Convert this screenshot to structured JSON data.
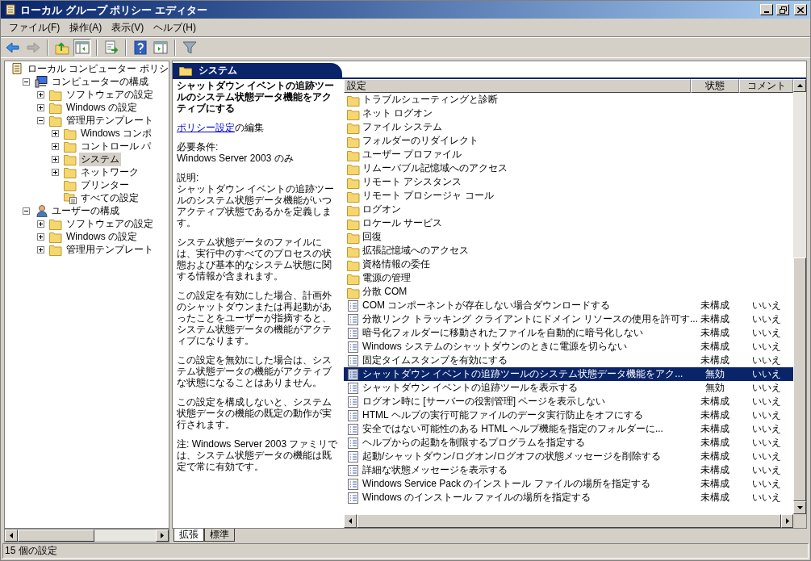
{
  "window": {
    "title": "ローカル グループ ポリシー エディター"
  },
  "menu": [
    "ファイル(F)",
    "操作(A)",
    "表示(V)",
    "ヘルプ(H)"
  ],
  "toolbar": [
    {
      "kind": "back",
      "disabled": false
    },
    {
      "kind": "forward",
      "disabled": true
    },
    {
      "kind": "sep"
    },
    {
      "kind": "up",
      "disabled": false
    },
    {
      "kind": "pane",
      "disabled": false,
      "selected": true
    },
    {
      "kind": "sep"
    },
    {
      "kind": "export",
      "disabled": false
    },
    {
      "kind": "sep"
    },
    {
      "kind": "help",
      "disabled": false
    },
    {
      "kind": "pane2",
      "disabled": false
    },
    {
      "kind": "sep"
    },
    {
      "kind": "filter",
      "disabled": false
    }
  ],
  "tree": [
    {
      "label": "ローカル コンピューター ポリシ",
      "kind": "doc",
      "has_toggle": false,
      "selected": false,
      "children": [
        {
          "label": "コンピューターの構成",
          "kind": "computer",
          "has_toggle": true,
          "selected": false,
          "children": [
            {
              "label": "ソフトウェアの設定",
              "kind": "folder",
              "has_toggle": true,
              "selected": false
            },
            {
              "label": "Windows の設定",
              "kind": "folder",
              "has_toggle": true,
              "selected": false
            },
            {
              "label": "管理用テンプレート",
              "kind": "folder",
              "has_toggle": true,
              "selected": false,
              "children": [
                {
                  "label": "Windows コンポ",
                  "kind": "folder",
                  "has_toggle": true,
                  "selected": false
                },
                {
                  "label": "コントロール パ",
                  "kind": "folder",
                  "has_toggle": true,
                  "selected": false
                },
                {
                  "label": "システム",
                  "kind": "folder",
                  "has_toggle": true,
                  "selected": true
                },
                {
                  "label": "ネットワーク",
                  "kind": "folder",
                  "has_toggle": true,
                  "selected": false
                },
                {
                  "label": "プリンター",
                  "kind": "folder",
                  "has_toggle": false,
                  "selected": false
                },
                {
                  "label": "すべての設定",
                  "kind": "allsettings",
                  "has_toggle": false,
                  "selected": false
                }
              ]
            }
          ]
        },
        {
          "label": "ユーザーの構成",
          "kind": "user",
          "has_toggle": true,
          "selected": false,
          "children": [
            {
              "label": "ソフトウェアの設定",
              "kind": "folder",
              "has_toggle": true,
              "selected": false
            },
            {
              "label": "Windows の設定",
              "kind": "folder",
              "has_toggle": true,
              "selected": false
            },
            {
              "label": "管理用テンプレート",
              "kind": "folder",
              "has_toggle": true,
              "selected": false
            }
          ]
        }
      ]
    }
  ],
  "pane_header": "システム",
  "description": {
    "title": "シャットダウン イベントの追跡ツールのシステム状態データ機能をアクティブにする",
    "edit_link": "ポリシー設定",
    "edit_suffix": "の編集",
    "requirements_label": "必要条件:",
    "requirements": "Windows Server 2003 のみ",
    "explanation_label": "説明:",
    "paragraphs": [
      "シャットダウン イベントの追跡ツールのシステム状態データ機能がいつアクティブ状態であるかを定義します。",
      "システム状態データのファイルには、実行中のすべてのプロセスの状態および基本的なシステム状態に関する情報が含まれます。",
      "この設定を有効にした場合、計画外のシャットダウンまたは再起動があったことをユーザーが指摘すると、システム状態データの機能がアクティブになります。",
      "この設定を無効にした場合は、システム状態データの機能がアクティブな状態になることはありません。",
      "この設定を構成しないと、システム状態データの機能の既定の動作が実行されます。",
      "注: Windows Server 2003 ファミリでは、システム状態データの機能は既定で常に有効です。"
    ]
  },
  "list": {
    "columns": [
      "設定",
      "状態",
      "コメント"
    ],
    "rows": [
      {
        "kind": "folder",
        "name": "トラブルシューティングと診断",
        "selected": false
      },
      {
        "kind": "folder",
        "name": "ネット ログオン",
        "selected": false
      },
      {
        "kind": "folder",
        "name": "ファイル システム",
        "selected": false
      },
      {
        "kind": "folder",
        "name": "フォルダーのリダイレクト",
        "selected": false
      },
      {
        "kind": "folder",
        "name": "ユーザー プロファイル",
        "selected": false
      },
      {
        "kind": "folder",
        "name": "リムーバブル記憶域へのアクセス",
        "selected": false
      },
      {
        "kind": "folder",
        "name": "リモート アシスタンス",
        "selected": false
      },
      {
        "kind": "folder",
        "name": "リモート プロシージャ コール",
        "selected": false
      },
      {
        "kind": "folder",
        "name": "ログオン",
        "selected": false
      },
      {
        "kind": "folder",
        "name": "ロケール サービス",
        "selected": false
      },
      {
        "kind": "folder",
        "name": "回復",
        "selected": false
      },
      {
        "kind": "folder",
        "name": "拡張記憶域へのアクセス",
        "selected": false
      },
      {
        "kind": "folder",
        "name": "資格情報の委任",
        "selected": false
      },
      {
        "kind": "folder",
        "name": "電源の管理",
        "selected": false
      },
      {
        "kind": "folder",
        "name": "分散 COM",
        "selected": false
      },
      {
        "kind": "setting",
        "name": "COM コンポーネントが存在しない場合ダウンロードする",
        "state": "未構成",
        "comment": "いいえ",
        "selected": false
      },
      {
        "kind": "setting",
        "name": "分散リンク トラッキング クライアントにドメイン リソースの使用を許可す...",
        "state": "未構成",
        "comment": "いいえ",
        "selected": false
      },
      {
        "kind": "setting",
        "name": "暗号化フォルダーに移動されたファイルを自動的に暗号化しない",
        "state": "未構成",
        "comment": "いいえ",
        "selected": false
      },
      {
        "kind": "setting",
        "name": "Windows システムのシャットダウンのときに電源を切らない",
        "state": "未構成",
        "comment": "いいえ",
        "selected": false
      },
      {
        "kind": "setting",
        "name": "固定タイムスタンプを有効にする",
        "state": "未構成",
        "comment": "いいえ",
        "selected": false
      },
      {
        "kind": "setting",
        "name": "シャットダウン イベントの追跡ツールのシステム状態データ機能をアク...",
        "state": "無効",
        "comment": "いいえ",
        "selected": true
      },
      {
        "kind": "setting",
        "name": "シャットダウン イベントの追跡ツールを表示する",
        "state": "無効",
        "comment": "いいえ",
        "selected": false
      },
      {
        "kind": "setting",
        "name": "ログオン時に [サーバーの役割管理] ページを表示しない",
        "state": "未構成",
        "comment": "いいえ",
        "selected": false
      },
      {
        "kind": "setting",
        "name": "HTML ヘルプの実行可能ファイルのデータ実行防止をオフにする",
        "state": "未構成",
        "comment": "いいえ",
        "selected": false
      },
      {
        "kind": "setting",
        "name": "安全ではない可能性のある HTML ヘルプ機能を指定のフォルダーに...",
        "state": "未構成",
        "comment": "いいえ",
        "selected": false
      },
      {
        "kind": "setting",
        "name": "ヘルプからの起動を制限するプログラムを指定する",
        "state": "未構成",
        "comment": "いいえ",
        "selected": false
      },
      {
        "kind": "setting",
        "name": "起動/シャットダウン/ログオン/ログオフの状態メッセージを削除する",
        "state": "未構成",
        "comment": "いいえ",
        "selected": false
      },
      {
        "kind": "setting",
        "name": "詳細な状態メッセージを表示する",
        "state": "未構成",
        "comment": "いいえ",
        "selected": false
      },
      {
        "kind": "setting",
        "name": "Windows Service Pack のインストール ファイルの場所を指定する",
        "state": "未構成",
        "comment": "いいえ",
        "selected": false
      },
      {
        "kind": "setting",
        "name": "Windows のインストール ファイルの場所を指定する",
        "state": "未構成",
        "comment": "いいえ",
        "selected": false
      }
    ]
  },
  "view_tabs": [
    {
      "label": "拡張",
      "selected": true
    },
    {
      "label": "標準",
      "selected": false
    }
  ],
  "status_bar": "15 個の設定"
}
